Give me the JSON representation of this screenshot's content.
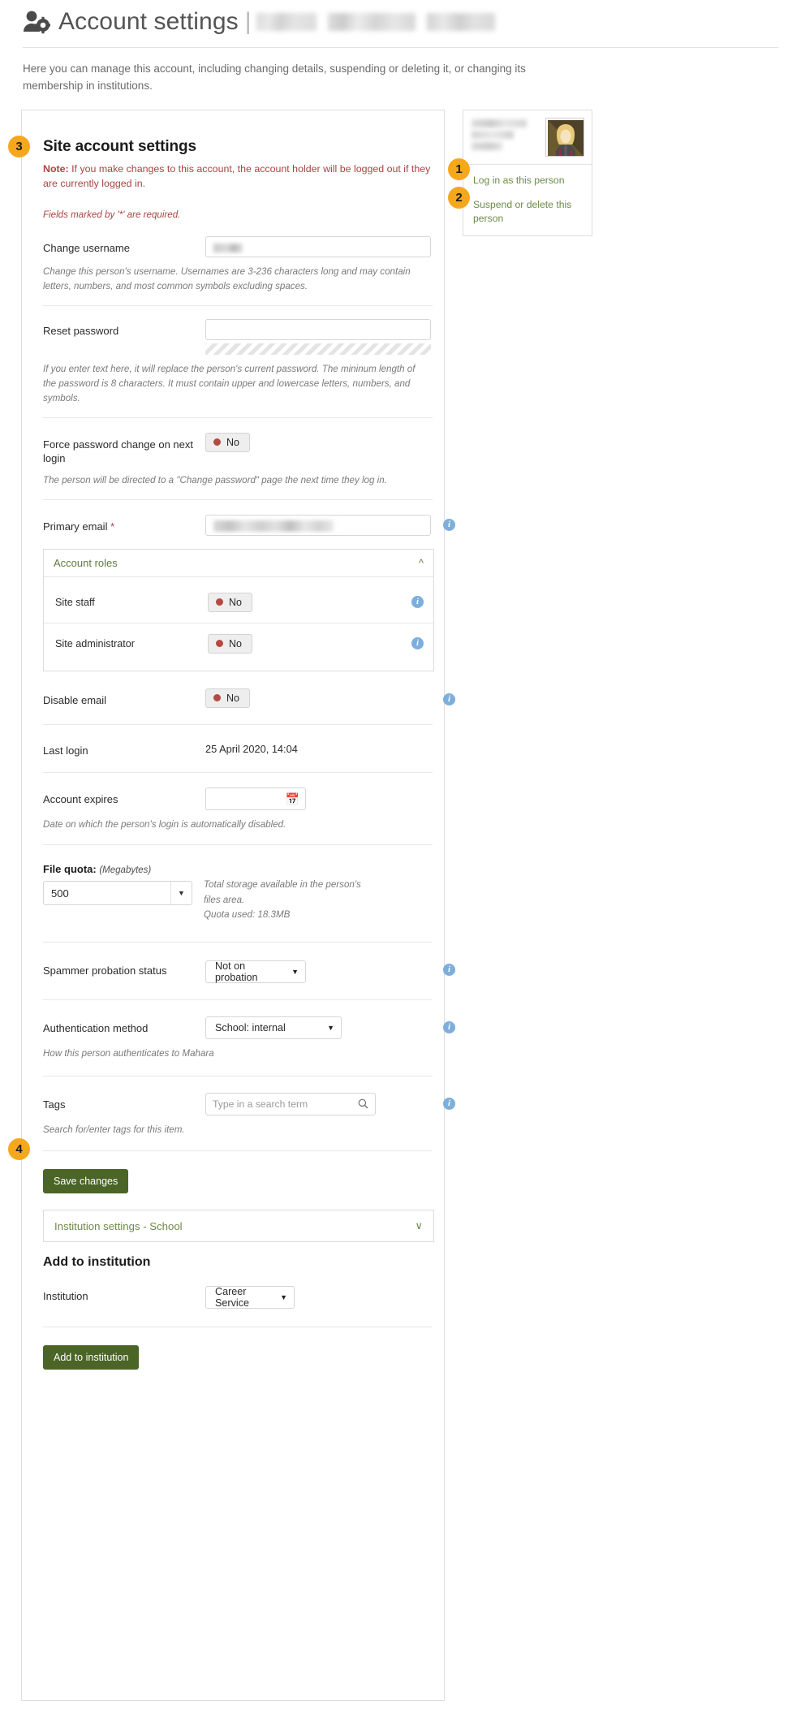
{
  "header": {
    "icon": "user-gear-icon",
    "title": "Account settings",
    "separator": "|",
    "redacted_name": "[redacted]"
  },
  "intro": "Here you can manage this account, including changing details, suspending or deleting it, or changing its membership in institutions.",
  "main": {
    "section_title": "Site account settings",
    "note_prefix": "Note:",
    "note_text": " If you make changes to this account, the account holder will be logged out if they are currently logged in.",
    "required_note": "Fields marked by '*' are required.",
    "fields": {
      "username": {
        "label": "Change username",
        "value": "",
        "hint": "Change this person's username. Usernames are 3-236 characters long and may contain letters, numbers, and most common symbols excluding spaces."
      },
      "password": {
        "label": "Reset password",
        "value": "",
        "hint": "If you enter text here, it will replace the person's current password. The mininum length of the password is 8 characters. It must contain upper and lowercase letters, numbers, and symbols."
      },
      "force_password_change": {
        "label": "Force password change on next login",
        "toggle_value": "No",
        "hint": "The person will be directed to a \"Change password\" page the next time they log in."
      },
      "primary_email": {
        "label": "Primary email",
        "required_mark": "*",
        "value": ""
      },
      "account_roles": {
        "panel_title": "Account roles",
        "chevron": "collapse-chevron-up-icon",
        "rows": [
          {
            "label": "Site staff",
            "toggle_value": "No"
          },
          {
            "label": "Site administrator",
            "toggle_value": "No"
          }
        ]
      },
      "disable_email": {
        "label": "Disable email",
        "toggle_value": "No"
      },
      "last_login": {
        "label": "Last login",
        "value": "25 April 2020, 14:04"
      },
      "account_expires": {
        "label": "Account expires",
        "value": "",
        "icon": "calendar-icon",
        "hint": "Date on which the person's login is automatically disabled."
      },
      "file_quota": {
        "label": "File quota:",
        "unit": "(Megabytes)",
        "value": "500",
        "hint_line1": "Total storage available in the person's files area.",
        "hint_line2": "Quota used: 18.3MB"
      },
      "spammer_probation": {
        "label": "Spammer probation status",
        "value": "Not on probation"
      },
      "authentication_method": {
        "label": "Authentication method",
        "value": "School: internal",
        "hint": "How this person authenticates to Mahara"
      },
      "tags": {
        "label": "Tags",
        "placeholder": "Type in a search term",
        "icon": "search-icon",
        "hint": "Search for/enter tags for this item."
      }
    },
    "save_button": "Save changes",
    "institution_accordion": {
      "title": "Institution settings - School",
      "chevron": "expand-chevron-down-icon"
    },
    "add_to_institution": {
      "heading": "Add to institution",
      "label": "Institution",
      "value": "Career Service",
      "button": "Add to institution"
    }
  },
  "sidebar": {
    "redacted_name": "[redacted]",
    "avatar": "user-avatar-image",
    "links": [
      {
        "label": "Log in as this person"
      },
      {
        "label": "Suspend or delete this person"
      }
    ]
  },
  "callouts": [
    {
      "number": "1"
    },
    {
      "number": "2"
    },
    {
      "number": "3"
    },
    {
      "number": "4"
    }
  ],
  "colors": {
    "badge": "#f5a81c",
    "green_button": "#4a6526",
    "link_green": "#6d8a4a",
    "note_red": "#a94442",
    "info_blue": "#7eaedb",
    "toggle_dot_red": "#b54a42"
  }
}
